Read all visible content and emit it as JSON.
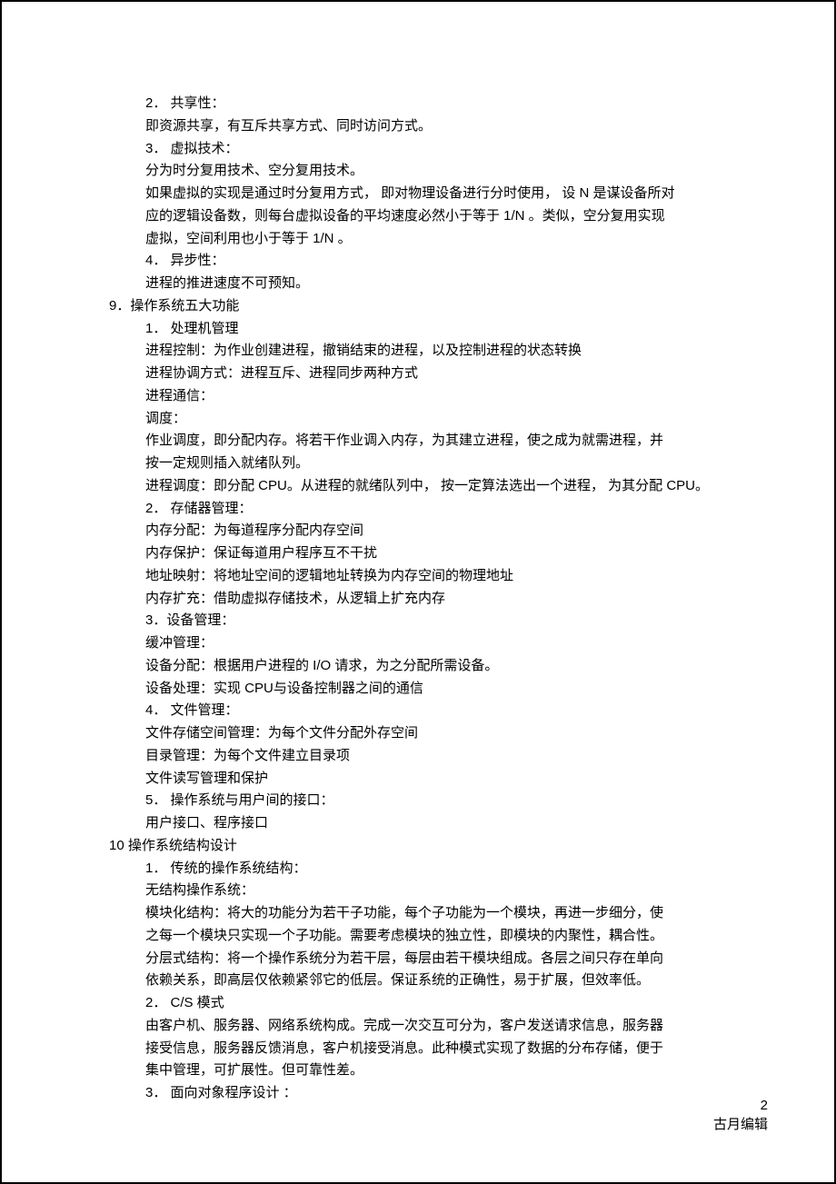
{
  "lines": [
    {
      "indent": 2,
      "text": "2．  共享性："
    },
    {
      "indent": 2,
      "text": "即资源共享，有互斥共享方式、同时访问方式。"
    },
    {
      "indent": 2,
      "text": "3．  虚拟技术："
    },
    {
      "indent": 2,
      "text": "分为时分复用技术、空分复用技术。"
    },
    {
      "indent": 2,
      "text": "如果虚拟的实现是通过时分复用方式，      即对物理设备进行分时使用，      设 N 是谋设备所对"
    },
    {
      "indent": 2,
      "text": "应的逻辑设备数，则每台虚拟设备的平均速度必然小于等于       1/N 。类似，空分复用实现"
    },
    {
      "indent": 2,
      "text": "虚拟，空间利用也小于等于     1/N  。"
    },
    {
      "indent": 2,
      "text": "4．  异步性："
    },
    {
      "indent": 2,
      "text": "进程的推进速度不可预知。"
    },
    {
      "indent": 1,
      "text": "9．操作系统五大功能"
    },
    {
      "indent": 2,
      "text": "1． 处理机管理"
    },
    {
      "indent": 2,
      "text": "进程控制：为作业创建进程，撤销结束的进程，以及控制进程的状态转换"
    },
    {
      "indent": 2,
      "text": "进程协调方式：进程互斥、进程同步两种方式"
    },
    {
      "indent": 2,
      "text": "进程通信："
    },
    {
      "indent": 2,
      "text": "调度："
    },
    {
      "indent": 2,
      "text": "作业调度，即分配内存。将若干作业调入内存，为其建立进程，使之成为就需进程，并"
    },
    {
      "indent": 2,
      "text": "按一定规则插入就绪队列。"
    },
    {
      "indent": 2,
      "text": "进程调度：即分配 CPU。从进程的就绪队列中，   按一定算法选出一个进程，   为其分配   CPU。"
    },
    {
      "indent": 2,
      "text": "2． 存储器管理："
    },
    {
      "indent": 2,
      "text": "内存分配：为每道程序分配内存空间"
    },
    {
      "indent": 2,
      "text": "内存保护：保证每道用户程序互不干扰"
    },
    {
      "indent": 2,
      "text": "地址映射：将地址空间的逻辑地址转换为内存空间的物理地址"
    },
    {
      "indent": 2,
      "text": "内存扩充：借助虚拟存储技术，从逻辑上扩充内存"
    },
    {
      "indent": 2,
      "text": "3．设备管理："
    },
    {
      "indent": 2,
      "text": "缓冲管理："
    },
    {
      "indent": 2,
      "text": "设备分配：根据用户进程的     I/O 请求，为之分配所需设备。"
    },
    {
      "indent": 2,
      "text": "设备处理：实现    CPU与设备控制器之间的通信"
    },
    {
      "indent": 2,
      "text": "4． 文件管理："
    },
    {
      "indent": 2,
      "text": "文件存储空间管理：为每个文件分配外存空间"
    },
    {
      "indent": 2,
      "text": "目录管理：为每个文件建立目录项"
    },
    {
      "indent": 2,
      "text": "文件读写管理和保护"
    },
    {
      "indent": 2,
      "text": "5． 操作系统与用户间的接口："
    },
    {
      "indent": 2,
      "text": "用户接口、程序接口"
    },
    {
      "indent": 1,
      "text": "10 操作系统结构设计"
    },
    {
      "indent": 2,
      "text": "1． 传统的操作系统结构："
    },
    {
      "indent": 2,
      "text": "无结构操作系统："
    },
    {
      "indent": 2,
      "text": "模块化结构：将大的功能分为若干子功能，每个子功能为一个模块，再进一步细分，使"
    },
    {
      "indent": 2,
      "text": "之每一个模块只实现一个子功能。需要考虑模块的独立性，即模块的内聚性，耦合性。"
    },
    {
      "indent": 2,
      "text": "分层式结构：将一个操作系统分为若干层，每层由若干模块组成。各层之间只存在单向"
    },
    {
      "indent": 2,
      "text": "依赖关系，即高层仅依赖紧邻它的低层。保证系统的正确性，易于扩展，但效率低。"
    },
    {
      "indent": 2,
      "text": "2． C/S 模式"
    },
    {
      "indent": 2,
      "text": "由客户机、服务器、网络系统构成。完成一次交互可分为，客户发送请求信息，服务器"
    },
    {
      "indent": 2,
      "text": "接受信息，服务器反馈消息，客户机接受消息。此种模式实现了数据的分布存储，便于"
    },
    {
      "indent": 2,
      "text": "集中管理，可扩展性。但可靠性差。"
    },
    {
      "indent": 2,
      "text": "3．  面向对象程序设计  ："
    }
  ],
  "footer": {
    "page_number": "2",
    "author": "古月编辑"
  }
}
